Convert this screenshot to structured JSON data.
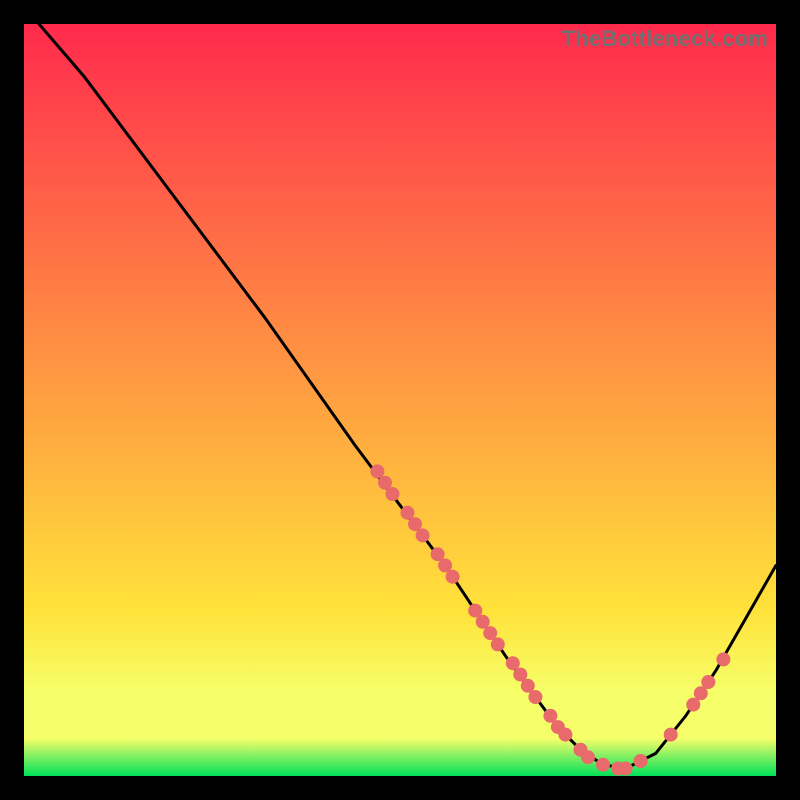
{
  "attribution": "TheBottleneck.com",
  "colors": {
    "top": "#ff2a4d",
    "mid": "#ffe23a",
    "band_top": "#f6ff6a",
    "band_bottom": "#00e05a",
    "curve": "#000000",
    "marker": "#e86a6a",
    "border": "#000000"
  },
  "chart_data": {
    "type": "line",
    "title": "",
    "xlabel": "",
    "ylabel": "",
    "xlim": [
      0,
      100
    ],
    "ylim": [
      0,
      100
    ],
    "curve": {
      "x": [
        2,
        8,
        14,
        20,
        26,
        32,
        38,
        44,
        50,
        56,
        60,
        64,
        68,
        71,
        74,
        77,
        80,
        84,
        88,
        92,
        96,
        100
      ],
      "y": [
        100,
        93,
        85,
        77,
        69,
        61,
        52.5,
        44,
        36,
        28,
        22,
        16,
        10.5,
        6.5,
        3.5,
        1.5,
        1,
        3,
        8,
        14,
        21,
        28
      ]
    },
    "series": [
      {
        "name": "markers",
        "x": [
          47,
          48,
          49,
          51,
          52,
          53,
          55,
          56,
          57,
          60,
          61,
          62,
          63,
          65,
          66,
          67,
          68,
          70,
          71,
          72,
          74,
          75,
          77,
          79,
          80,
          82,
          86,
          89,
          90,
          91,
          93
        ],
        "y": [
          40.5,
          39,
          37.5,
          35,
          33.5,
          32,
          29.5,
          28,
          26.5,
          22,
          20.5,
          19,
          17.5,
          15,
          13.5,
          12,
          10.5,
          8,
          6.5,
          5.5,
          3.5,
          2.5,
          1.5,
          1,
          1,
          2.0,
          5.5,
          9.5,
          11,
          12.5,
          15.5
        ]
      }
    ],
    "bands": [
      {
        "y_from": 0,
        "y_to": 5,
        "color_key": "band_bottom"
      },
      {
        "y_from": 5,
        "y_to": 11,
        "color_key": "band_top"
      }
    ]
  }
}
